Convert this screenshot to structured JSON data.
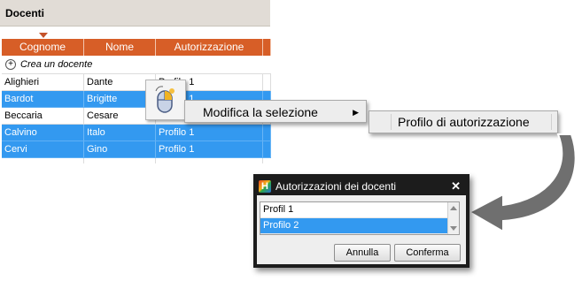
{
  "panel": {
    "title": "Docenti"
  },
  "table": {
    "columns": [
      "Cognome",
      "Nome",
      "Autorizzazione"
    ],
    "create_label": "Crea un docente",
    "rows": [
      {
        "cognome": "Alighieri",
        "nome": "Dante",
        "auth": "Profilo 1",
        "selected": false
      },
      {
        "cognome": "Bardot",
        "nome": "Brigitte",
        "auth": "Profilo 1",
        "selected": true
      },
      {
        "cognome": "Beccaria",
        "nome": "Cesare",
        "auth": "Profilo 1",
        "selected": false
      },
      {
        "cognome": "Calvino",
        "nome": "Italo",
        "auth": "Profilo 1",
        "selected": true
      },
      {
        "cognome": "Cervi",
        "nome": "Gino",
        "auth": "Profilo 1",
        "selected": true
      }
    ]
  },
  "context_menu": {
    "item": "Modifica la selezione",
    "submenu_item": "Profilo di autorizzazione"
  },
  "dialog": {
    "title": "Autorizzazioni dei docenti",
    "options": [
      "Profil 1",
      "Profilo 2"
    ],
    "selected_option": "Profilo 2",
    "cancel_label": "Annulla",
    "confirm_label": "Conferma"
  },
  "colors": {
    "header_orange": "#d75e27",
    "selection_blue": "#3399f0",
    "dialog_frame": "#1c1c1c",
    "arrow_gray": "#6f6f6f"
  }
}
